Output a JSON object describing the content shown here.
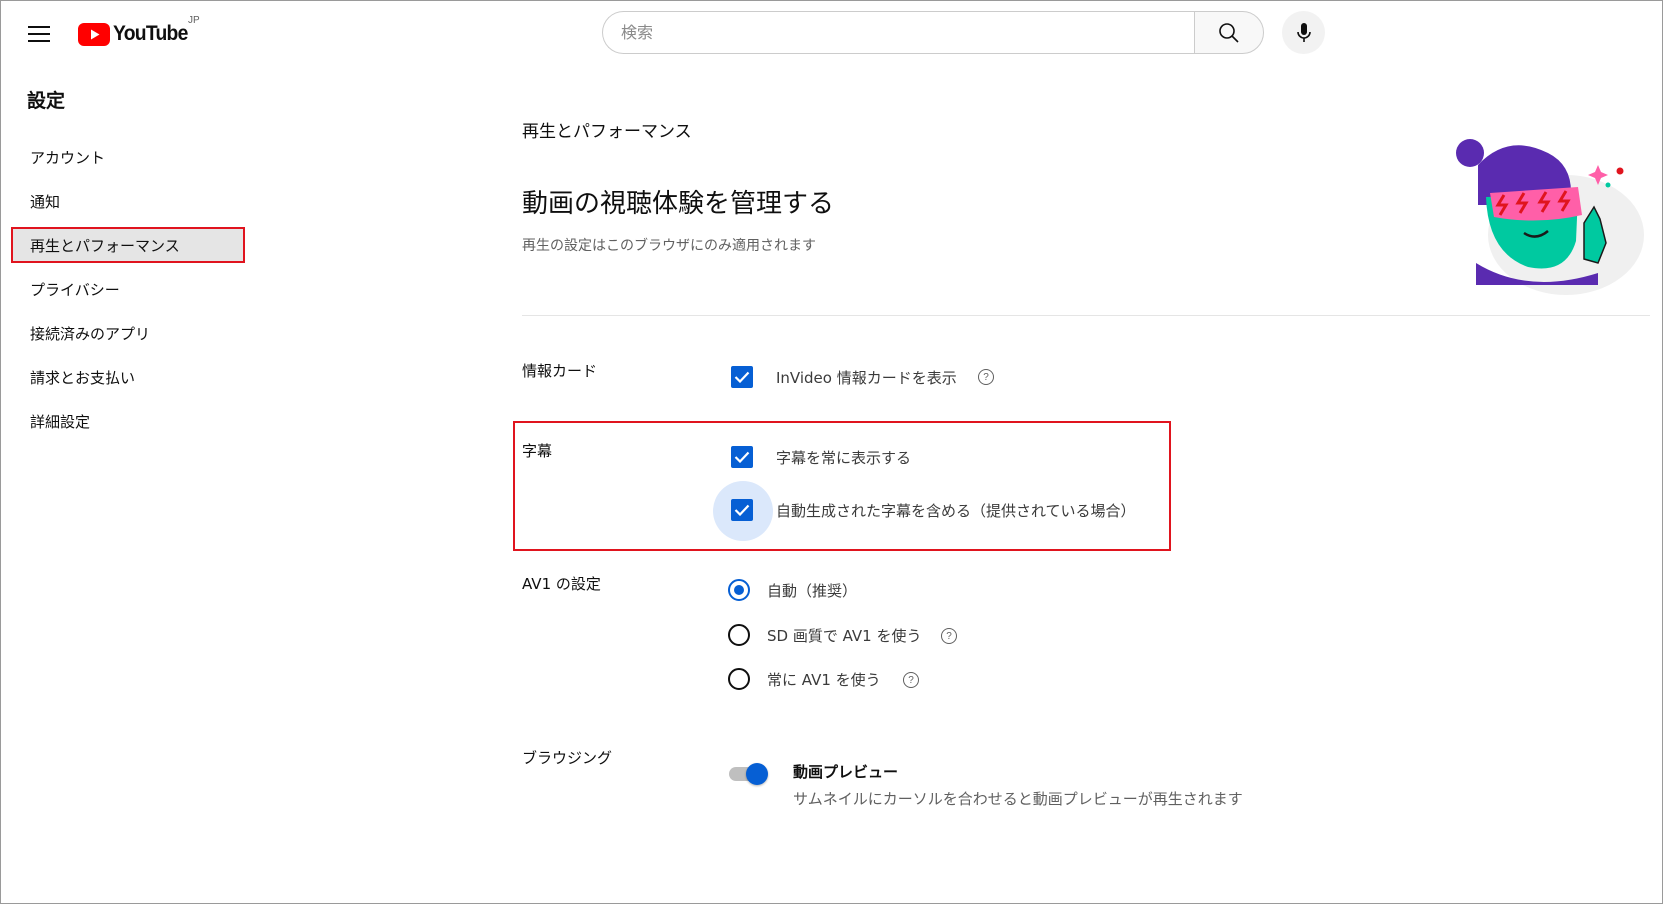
{
  "header": {
    "logo_text": "YouTube",
    "region": "JP",
    "search_placeholder": "検索"
  },
  "sidebar": {
    "title": "設定",
    "items": [
      {
        "label": "アカウント",
        "active": false
      },
      {
        "label": "通知",
        "active": false
      },
      {
        "label": "再生とパフォーマンス",
        "active": true
      },
      {
        "label": "プライバシー",
        "active": false
      },
      {
        "label": "接続済みのアプリ",
        "active": false
      },
      {
        "label": "請求とお支払い",
        "active": false
      },
      {
        "label": "詳細設定",
        "active": false
      }
    ]
  },
  "main": {
    "section_label": "再生とパフォーマンス",
    "heading": "動画の視聴体験を管理する",
    "subheading": "再生の設定はこのブラウザにのみ適用されます",
    "info_cards": {
      "label": "情報カード",
      "option": {
        "text": "InVideo 情報カードを表示",
        "checked": true
      }
    },
    "captions": {
      "label": "字幕",
      "options": [
        {
          "text": "字幕を常に表示する",
          "checked": true
        },
        {
          "text": "自動生成された字幕を含める（提供されている場合）",
          "checked": true
        }
      ]
    },
    "av1": {
      "label": "AV1 の設定",
      "options": [
        {
          "text": "自動（推奨）",
          "selected": true
        },
        {
          "text": "SD 画質で AV1 を使う",
          "selected": false
        },
        {
          "text": "常に AV1 を使う",
          "selected": false
        }
      ]
    },
    "browsing": {
      "label": "ブラウジング",
      "toggle_title": "動画プレビュー",
      "toggle_desc": "サムネイルにカーソルを合わせると動画プレビューが再生されます",
      "enabled": true
    },
    "help_glyph": "?"
  },
  "colors": {
    "accent": "#065fd4",
    "highlight": "#e0141e",
    "logo_red": "#ff0000"
  }
}
